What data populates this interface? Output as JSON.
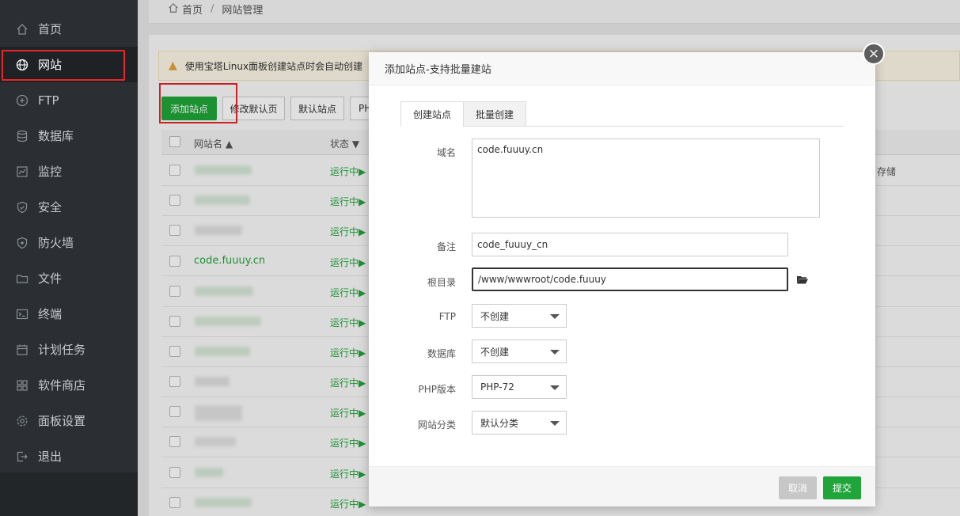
{
  "breadcrumb": {
    "home": "首页",
    "sep": "/",
    "current": "网站管理"
  },
  "sidebar": {
    "items": [
      {
        "label": "首页",
        "icon": "home-icon"
      },
      {
        "label": "网站",
        "icon": "globe-icon",
        "active": true
      },
      {
        "label": "FTP",
        "icon": "ftp-icon"
      },
      {
        "label": "数据库",
        "icon": "database-icon"
      },
      {
        "label": "监控",
        "icon": "monitor-icon"
      },
      {
        "label": "安全",
        "icon": "shield-icon"
      },
      {
        "label": "防火墙",
        "icon": "firewall-icon"
      },
      {
        "label": "文件",
        "icon": "folder-icon"
      },
      {
        "label": "终端",
        "icon": "terminal-icon"
      },
      {
        "label": "计划任务",
        "icon": "calendar-icon"
      },
      {
        "label": "软件商店",
        "icon": "apps-icon"
      },
      {
        "label": "面板设置",
        "icon": "settings-icon"
      },
      {
        "label": "退出",
        "icon": "logout-icon"
      }
    ]
  },
  "notice": {
    "text": "使用宝塔Linux面板创建站点时会自动创建"
  },
  "toolbar": {
    "add": "添加站点",
    "edit_default": "修改默认页",
    "default_site": "默认站点",
    "php": "PH"
  },
  "table": {
    "headers": {
      "name": "网站名",
      "status": "状态"
    },
    "status_text": "运行中▶",
    "visible_site": "code.fuuuy.cn",
    "side_text": "存储"
  },
  "modal": {
    "title": "添加站点-支持批量建站",
    "tabs": [
      "创建站点",
      "批量创建"
    ],
    "fields": {
      "domain_label": "域名",
      "domain_value": "code.fuuuy.cn",
      "remark_label": "备注",
      "remark_value": "code_fuuuy_cn",
      "root_label": "根目录",
      "root_value": "/www/wwwroot/code.fuuuy",
      "ftp_label": "FTP",
      "ftp_value": "不创建",
      "db_label": "数据库",
      "db_value": "不创建",
      "php_label": "PHP版本",
      "php_value": "PHP-72",
      "category_label": "网站分类",
      "category_value": "默认分类"
    },
    "buttons": {
      "cancel": "取消",
      "submit": "提交",
      "close": "×"
    }
  },
  "colors": {
    "primary": "#20a53a",
    "sidebar_bg": "#2b2f33",
    "highlight": "#e5262a"
  }
}
